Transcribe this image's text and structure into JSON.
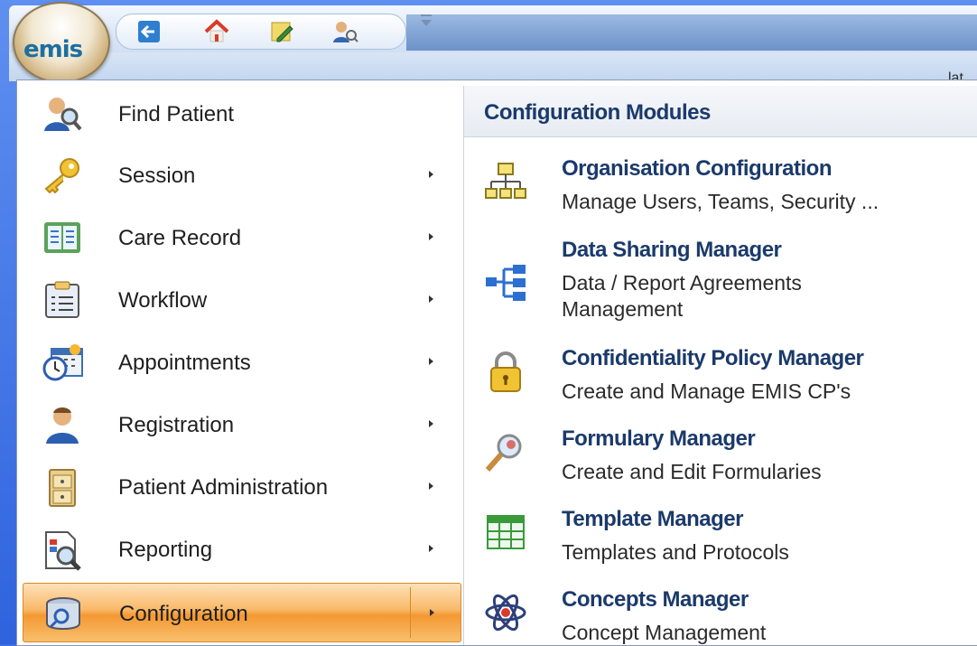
{
  "app": {
    "orb_label": "emis",
    "corner_text": "lat"
  },
  "quick_access": [
    "back-arrow-icon",
    "home-icon",
    "edit-pencil-icon",
    "find-user-icon"
  ],
  "menu": {
    "items": [
      {
        "label": "Find Patient",
        "icon": "find-patient-icon",
        "submenu": false,
        "active": false
      },
      {
        "label": "Session",
        "icon": "key-icon",
        "submenu": true,
        "active": false
      },
      {
        "label": "Care Record",
        "icon": "care-record-icon",
        "submenu": true,
        "active": false
      },
      {
        "label": "Workflow",
        "icon": "clipboard-icon",
        "submenu": true,
        "active": false
      },
      {
        "label": "Appointments",
        "icon": "calendar-clock-icon",
        "submenu": true,
        "active": false
      },
      {
        "label": "Registration",
        "icon": "person-icon",
        "submenu": true,
        "active": false
      },
      {
        "label": "Patient Administration",
        "icon": "cabinet-icon",
        "submenu": true,
        "active": false
      },
      {
        "label": "Reporting",
        "icon": "report-magnifier-icon",
        "submenu": true,
        "active": false
      },
      {
        "label": "Configuration",
        "icon": "configuration-icon",
        "submenu": true,
        "active": true
      }
    ]
  },
  "submenu": {
    "header": "Configuration Modules",
    "modules": [
      {
        "title": "Organisation Configuration",
        "desc": [
          "Manage Users, Teams, Security ..."
        ],
        "icon": "org-chart-icon"
      },
      {
        "title": "Data Sharing Manager",
        "desc": [
          "Data / Report Agreements",
          "Management"
        ],
        "icon": "data-share-icon"
      },
      {
        "title": "Confidentiality Policy Manager",
        "desc": [
          "Create and Manage EMIS CP's"
        ],
        "icon": "padlock-icon"
      },
      {
        "title": "Formulary Manager",
        "desc": [
          "Create and Edit Formularies"
        ],
        "icon": "magnifier-icon"
      },
      {
        "title": "Template Manager",
        "desc": [
          "Templates and Protocols"
        ],
        "icon": "grid-table-icon"
      },
      {
        "title": "Concepts Manager",
        "desc": [
          "Concept Management"
        ],
        "icon": "atom-icon"
      }
    ]
  },
  "colors": {
    "accent": "#f49832",
    "header_text": "#1b3a6b",
    "background": "#3d6fe0"
  }
}
